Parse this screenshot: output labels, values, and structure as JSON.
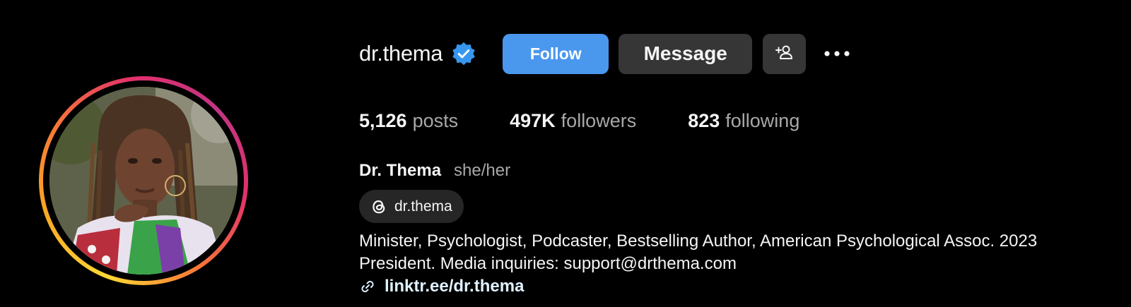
{
  "profile": {
    "username": "dr.thema",
    "verified": true,
    "full_name": "Dr. Thema",
    "pronouns": "she/her"
  },
  "actions": {
    "follow_label": "Follow",
    "message_label": "Message"
  },
  "stats": {
    "posts_count": "5,126",
    "posts_label": "posts",
    "followers_count": "497K",
    "followers_label": "followers",
    "following_count": "823",
    "following_label": "following"
  },
  "threads": {
    "handle": "dr.thema"
  },
  "bio": {
    "text": "Minister, Psychologist, Podcaster, Bestselling Author, American Psychological Assoc. 2023 President. Media inquiries: support@drthema.com",
    "link_text": "linktr.ee/dr.thema"
  },
  "icons": {
    "verified": "verified-badge-icon",
    "add_user": "add-person-icon",
    "more": "more-options-icon",
    "threads": "threads-icon",
    "link": "link-icon"
  },
  "colors": {
    "background": "#000000",
    "follow_button": "#4a97ee",
    "secondary_button": "#363636",
    "verified_badge": "#3797f0",
    "muted_text": "#a8a8a8",
    "link_text": "#e0f1ff"
  }
}
